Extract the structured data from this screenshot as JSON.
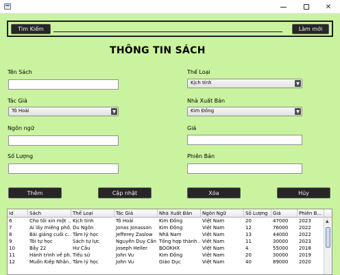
{
  "window": {
    "min_symbol": "",
    "close_symbol": "✕"
  },
  "toolbar": {
    "search_label": "Tìm Kiếm",
    "refresh_label": "Làm mới"
  },
  "form": {
    "title": "THÔNG TIN SÁCH",
    "ten_sach_label": "Tên Sách",
    "ten_sach_value": "",
    "the_loai_label": "Thể Loại",
    "the_loai_value": "Kịch tính",
    "tac_gia_label": "Tác Giả",
    "tac_gia_value": "Tô Hoài",
    "nxb_label": "Nhà Xuất Bản",
    "nxb_value": "Kim Đồng",
    "ngon_ngu_label": "Ngôn ngữ",
    "ngon_ngu_value": "",
    "gia_label": "Giá",
    "gia_value": "",
    "so_luong_label": "Số Lượng",
    "so_luong_value": "",
    "phien_ban_label": "Phiên Bản",
    "phien_ban_value": "",
    "dropdown_arrow": "▼"
  },
  "actions": {
    "add": "Thêm",
    "update": "Cập nhật",
    "delete": "Xóa",
    "cancel": "Hủy"
  },
  "table": {
    "columns": [
      "Id",
      "Sách",
      "Thể Loại",
      "Tác Giả",
      "Nhà Xuất Bản",
      "Ngôn Ngữ",
      "Số Lượng",
      "Giá",
      "Phiên B..."
    ],
    "rows": [
      [
        "6",
        "Cho tôi xin một ...",
        "Kịch tính",
        "Tô Hoài",
        "Kim Đồng",
        "Việt Nam",
        "20",
        "47000",
        "2023"
      ],
      [
        "7",
        "Ai lấy miếng phô...",
        "Du Ngôn",
        "Jonas Jonasson",
        "Kim Đồng",
        "Việt Nam",
        "12",
        "76000",
        "2022"
      ],
      [
        "8",
        "Bài giảng cuối c...",
        "Tâm lý học",
        "Jefferey Zaslow",
        "Nhã Nam",
        "Việt Nam",
        "13",
        "44000",
        "2022"
      ],
      [
        "9",
        "Tôi tự học",
        "Sách tự lực",
        "Nguyễn Duy Cần",
        "Tổng hợp thành ...",
        "Việt Nam",
        "11",
        "30000",
        "2023"
      ],
      [
        "10",
        "Bẫy 22",
        "Hư Cấu",
        "Joseph Heller",
        "BOOKHX",
        "Việt Nam",
        "4",
        "55000",
        "2018"
      ],
      [
        "11",
        "Hành trình về ph...",
        "Tiểu sử",
        "John Vu",
        "Kim Đồng",
        "Việt Nam",
        "20",
        "30000",
        "2019"
      ],
      [
        "12",
        "Muốn Kiếp Nhân...",
        "Tâm lý học",
        "John Vu",
        "Giáo Dục",
        "Việt Nam",
        "40",
        "89000",
        "2020"
      ]
    ],
    "scroll_up": "▲"
  }
}
